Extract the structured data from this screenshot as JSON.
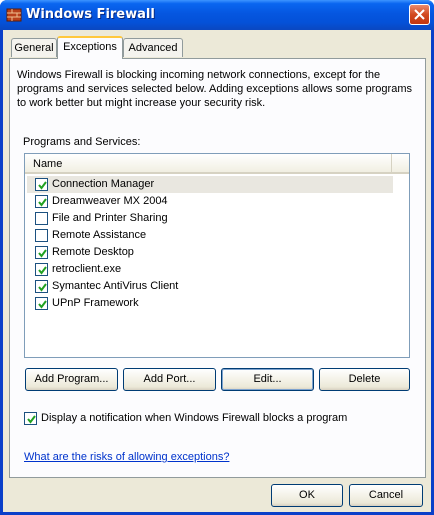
{
  "window": {
    "title": "Windows Firewall",
    "accent": "#0451d8"
  },
  "tabs": [
    {
      "label": "General",
      "active": false
    },
    {
      "label": "Exceptions",
      "active": true
    },
    {
      "label": "Advanced",
      "active": false
    }
  ],
  "exceptions": {
    "intro": "Windows Firewall is blocking incoming network connections, except for the programs and services selected below. Adding exceptions allows some programs to work better but might increase your security risk.",
    "list_label": "Programs and Services:",
    "column_header": "Name",
    "items": [
      {
        "label": "Connection Manager",
        "checked": true,
        "selected": true
      },
      {
        "label": "Dreamweaver MX 2004",
        "checked": true,
        "selected": false
      },
      {
        "label": "File and Printer Sharing",
        "checked": false,
        "selected": false
      },
      {
        "label": "Remote Assistance",
        "checked": false,
        "selected": false
      },
      {
        "label": "Remote Desktop",
        "checked": true,
        "selected": false
      },
      {
        "label": "retroclient.exe",
        "checked": true,
        "selected": false
      },
      {
        "label": "Symantec AntiVirus Client",
        "checked": true,
        "selected": false
      },
      {
        "label": "UPnP Framework",
        "checked": true,
        "selected": false
      }
    ],
    "buttons": {
      "add_program": "Add Program...",
      "add_port": "Add Port...",
      "edit": "Edit...",
      "delete": "Delete"
    },
    "notify": {
      "label": "Display a notification when Windows Firewall blocks a program",
      "checked": true
    },
    "risk_link": "What are the risks of allowing exceptions?"
  },
  "footer": {
    "ok": "OK",
    "cancel": "Cancel"
  }
}
